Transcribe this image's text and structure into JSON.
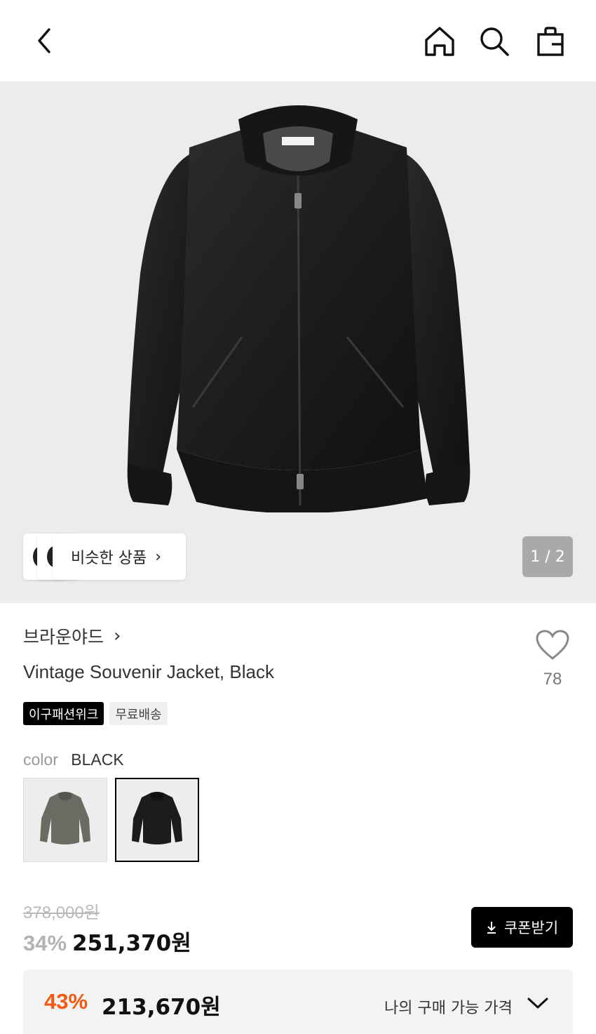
{
  "header": {
    "icons": [
      "back-icon",
      "home-icon",
      "search-icon",
      "shopping-bag-icon"
    ]
  },
  "gallery": {
    "similar_label": "비슷한 상품",
    "pager": "1 / 2"
  },
  "product": {
    "brand": "브라운야드",
    "title": "Vintage Souvenir Jacket, Black",
    "like_count": "78",
    "tags": [
      "이구패션위크",
      "무료배송"
    ],
    "color_label": "color",
    "color_value": "BLACK",
    "swatches": [
      "khaki",
      "black"
    ]
  },
  "price": {
    "original": "378,000원",
    "discount_pct": "34%",
    "sale": "251,370원",
    "coupon_label": "쿠폰받기",
    "my_pct": "43%",
    "my_price": "213,670원",
    "my_label": "나의 구매 가능 가격"
  },
  "colors": {
    "accent": "#f25a12",
    "dark": "#000000",
    "hero_bg": "#ececec"
  }
}
